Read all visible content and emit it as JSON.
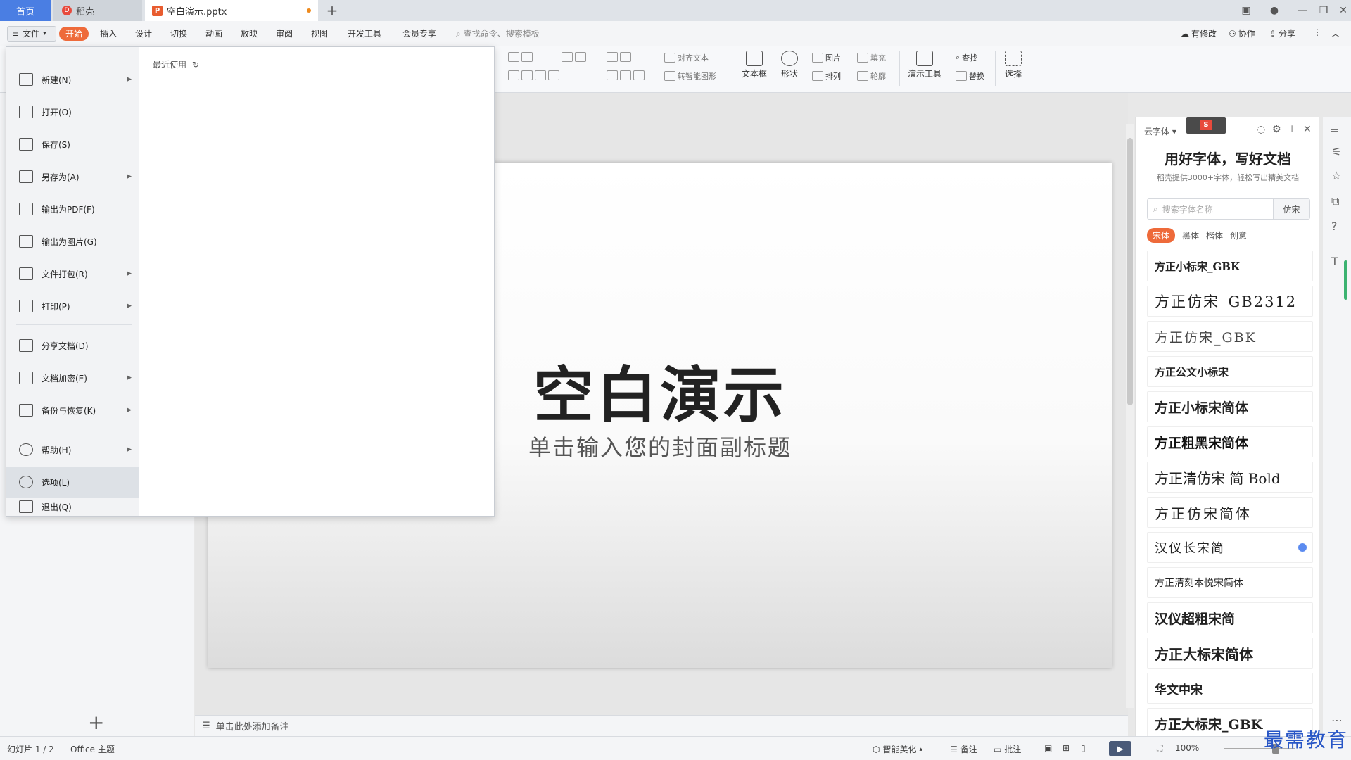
{
  "tabs": {
    "home": "首页",
    "daoke": "稻壳",
    "document": "空白演示.pptx",
    "add": "+"
  },
  "menubar": {
    "file": "文件",
    "items": [
      "开始",
      "插入",
      "设计",
      "切换",
      "动画",
      "放映",
      "审阅",
      "视图",
      "开发工具",
      "会员专享"
    ],
    "search_placeholder": "查找命令、搜索模板",
    "right": {
      "modified": "有修改",
      "collab": "协作",
      "share": "分享"
    }
  },
  "ribbon": {
    "align_text": "对齐文本",
    "smart_shape": "转智能图形",
    "textbox": "文本框",
    "shape": "形状",
    "picture": "图片",
    "fill": "填充",
    "arrange": "排列",
    "outline": "轮廓",
    "present_tools": "演示工具",
    "find": "查找",
    "replace": "替换",
    "select": "选择"
  },
  "file_menu": {
    "items": [
      {
        "label": "新建(N)",
        "arrow": true
      },
      {
        "label": "打开(O)",
        "arrow": false
      },
      {
        "label": "保存(S)",
        "arrow": false
      },
      {
        "label": "另存为(A)",
        "arrow": true
      },
      {
        "label": "输出为PDF(F)",
        "arrow": false
      },
      {
        "label": "输出为图片(G)",
        "arrow": false
      },
      {
        "label": "文件打包(R)",
        "arrow": true
      },
      {
        "label": "打印(P)",
        "arrow": true
      },
      {
        "label": "分享文档(D)",
        "arrow": false
      },
      {
        "label": "文档加密(E)",
        "arrow": true
      },
      {
        "label": "备份与恢复(K)",
        "arrow": true
      },
      {
        "label": "帮助(H)",
        "arrow": true
      },
      {
        "label": "选项(L)",
        "arrow": false
      },
      {
        "label": "退出(Q)",
        "arrow": false
      }
    ],
    "recent": "最近使用"
  },
  "slide": {
    "title": "空白演示",
    "subtitle": "单击输入您的封面副标题"
  },
  "notes_placeholder": "单击此处添加备注",
  "font_panel": {
    "header": "云字体",
    "title": "用好字体，写好文档",
    "subtitle": "稻壳提供3000+字体，轻松写出精美文档",
    "search_placeholder": "搜索字体名称",
    "search_button": "仿宋",
    "categories": [
      "宋体",
      "黑体",
      "楷体",
      "创意"
    ],
    "fonts": [
      "方正小标宋_GBK",
      "方正仿宋_GB2312",
      "方正仿宋_GBK",
      "方正公文小标宋",
      "方正小标宋简体",
      "方正粗黑宋简体",
      "方正清仿宋 简 Bold",
      "方正仿宋简体",
      "汉仪长宋简",
      "方正清刻本悦宋简体",
      "汉仪超粗宋简",
      "方正大标宋简体",
      "华文中宋",
      "方正大标宋_GBK"
    ]
  },
  "statusbar": {
    "slide_count": "幻灯片 1 / 2",
    "theme": "Office 主题",
    "beautify": "智能美化",
    "notes": "备注",
    "comments": "批注",
    "zoom": "100%"
  },
  "watermark": "最需教育"
}
